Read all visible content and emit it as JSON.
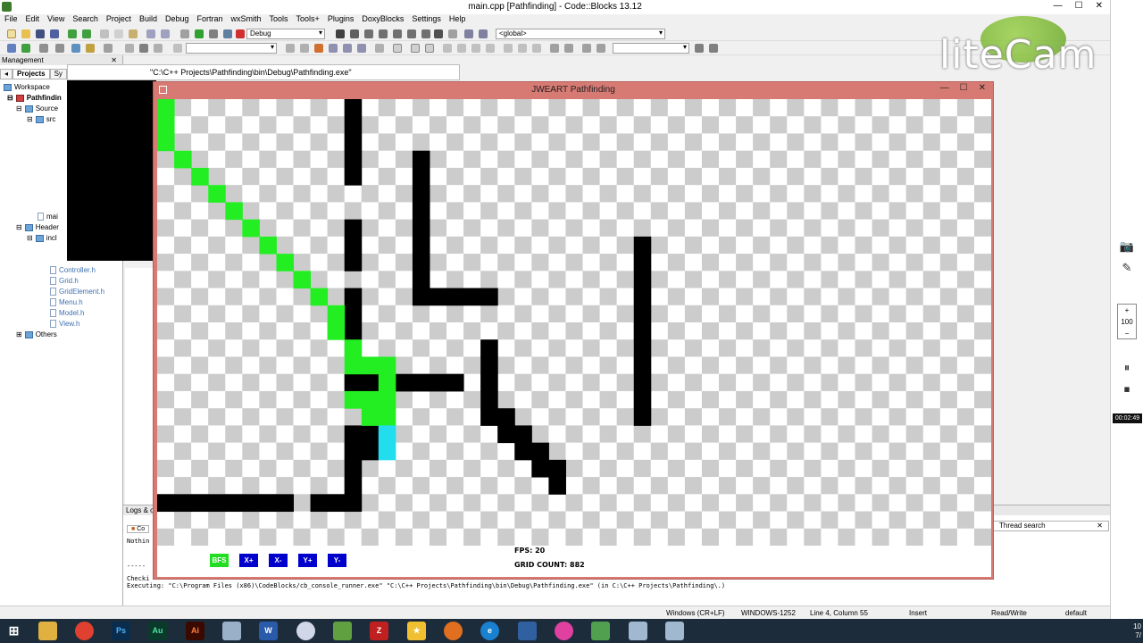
{
  "window": {
    "title": "main.cpp [Pathfinding] - Code::Blocks 13.12",
    "controls": [
      "—",
      "☐",
      "✕"
    ]
  },
  "menu": [
    "File",
    "Edit",
    "View",
    "Search",
    "Project",
    "Build",
    "Debug",
    "Fortran",
    "wxSmith",
    "Tools",
    "Tools+",
    "Plugins",
    "DoxyBlocks",
    "Settings",
    "Help"
  ],
  "toolbar": {
    "build_target": "Debug",
    "scope": "<global>"
  },
  "management": {
    "header": "Management",
    "tabs": [
      "Projects",
      "Sy"
    ],
    "tree": [
      {
        "label": "Workspace",
        "type": "folder"
      },
      {
        "label": "Pathfindin",
        "type": "project"
      },
      {
        "label": "Source",
        "type": "folder"
      },
      {
        "label": "src",
        "type": "folder"
      },
      {
        "label": "mai",
        "type": "file"
      },
      {
        "label": "Header",
        "type": "folder"
      },
      {
        "label": "incl",
        "type": "folder"
      },
      {
        "label": "Controller.h",
        "type": "file"
      },
      {
        "label": "Grid.h",
        "type": "file"
      },
      {
        "label": "GridElement.h",
        "type": "file"
      },
      {
        "label": "Menu.h",
        "type": "file"
      },
      {
        "label": "Model.h",
        "type": "file"
      },
      {
        "label": "View.h",
        "type": "file"
      },
      {
        "label": "Others",
        "type": "folder"
      }
    ]
  },
  "console_window": {
    "title": "\"C:\\C++ Projects\\Pathfinding\\bin\\Debug\\Pathfinding.exe\""
  },
  "logs": {
    "header": "Logs & ot",
    "tab": "Co",
    "lines": [
      "Nothin",
      "-----",
      "Checki",
      "Executing: \"C:\\Program Files (x86)\\CodeBlocks/cb_console_runner.exe\" \"C:\\C++ Projects\\Pathfinding\\bin\\Debug\\Pathfinding.exe\"  (in C:\\C++ Projects\\Pathfinding\\.)"
    ],
    "thread_search": "Thread search"
  },
  "statusbar": {
    "line_endings": "Windows (CR+LF)",
    "encoding": "WINDOWS-1252",
    "position": "Line 4, Column 55",
    "mode": "Insert",
    "access": "Read/Write",
    "profile": "default"
  },
  "pathfinding": {
    "title": "JWEART Pathfinding",
    "buttons": [
      {
        "label": "BFS",
        "color": "#22dd22"
      },
      {
        "label": "X+",
        "color": "#0000cc"
      },
      {
        "label": "X-",
        "color": "#0000cc"
      },
      {
        "label": "Y+",
        "color": "#0000cc"
      },
      {
        "label": "Y-",
        "color": "#0000cc"
      }
    ],
    "fps": "FPS: 20",
    "grid_count": "GRID COUNT: 882",
    "grid": {
      "cols": 49,
      "rows": 26,
      "walls": [
        [
          11,
          0
        ],
        [
          11,
          1
        ],
        [
          11,
          2
        ],
        [
          11,
          3
        ],
        [
          11,
          4
        ],
        [
          15,
          3
        ],
        [
          15,
          4
        ],
        [
          15,
          5
        ],
        [
          15,
          6
        ],
        [
          15,
          7
        ],
        [
          15,
          8
        ],
        [
          15,
          9
        ],
        [
          15,
          10
        ],
        [
          15,
          11
        ],
        [
          11,
          7
        ],
        [
          11,
          8
        ],
        [
          11,
          9
        ],
        [
          16,
          11
        ],
        [
          17,
          11
        ],
        [
          18,
          11
        ],
        [
          19,
          11
        ],
        [
          11,
          11
        ],
        [
          11,
          12
        ],
        [
          11,
          13
        ],
        [
          11,
          16
        ],
        [
          12,
          16
        ],
        [
          13,
          16
        ],
        [
          14,
          16
        ],
        [
          15,
          16
        ],
        [
          16,
          16
        ],
        [
          17,
          16
        ],
        [
          19,
          14
        ],
        [
          19,
          15
        ],
        [
          19,
          16
        ],
        [
          19,
          17
        ],
        [
          19,
          18
        ],
        [
          20,
          18
        ],
        [
          20,
          19
        ],
        [
          21,
          19
        ],
        [
          21,
          20
        ],
        [
          22,
          20
        ],
        [
          22,
          21
        ],
        [
          23,
          21
        ],
        [
          23,
          22
        ],
        [
          28,
          8
        ],
        [
          28,
          9
        ],
        [
          28,
          10
        ],
        [
          28,
          11
        ],
        [
          28,
          12
        ],
        [
          28,
          13
        ],
        [
          28,
          14
        ],
        [
          28,
          15
        ],
        [
          28,
          16
        ],
        [
          28,
          17
        ],
        [
          28,
          18
        ],
        [
          11,
          19
        ],
        [
          12,
          19
        ],
        [
          11,
          20
        ],
        [
          12,
          20
        ],
        [
          11,
          21
        ],
        [
          11,
          22
        ],
        [
          0,
          23
        ],
        [
          1,
          23
        ],
        [
          2,
          23
        ],
        [
          3,
          23
        ],
        [
          4,
          23
        ],
        [
          5,
          23
        ],
        [
          6,
          23
        ],
        [
          7,
          23
        ],
        [
          9,
          23
        ],
        [
          10,
          23
        ],
        [
          11,
          23
        ]
      ],
      "path": [
        [
          0,
          0
        ],
        [
          0,
          1
        ],
        [
          0,
          2
        ],
        [
          1,
          3
        ],
        [
          2,
          4
        ],
        [
          3,
          5
        ],
        [
          4,
          6
        ],
        [
          5,
          7
        ],
        [
          6,
          8
        ],
        [
          7,
          9
        ],
        [
          8,
          10
        ],
        [
          9,
          11
        ],
        [
          10,
          12
        ],
        [
          10,
          13
        ],
        [
          11,
          14
        ],
        [
          11,
          15
        ],
        [
          12,
          15
        ],
        [
          13,
          15
        ],
        [
          13,
          16
        ],
        [
          13,
          17
        ],
        [
          13,
          18
        ],
        [
          11,
          17
        ],
        [
          12,
          17
        ],
        [
          12,
          18
        ]
      ],
      "goal": [
        [
          13,
          19
        ],
        [
          13,
          20
        ]
      ],
      "path_color": "#22ee22",
      "goal_color": "#22ddee",
      "wall_color": "#000000"
    }
  },
  "right_panel": {
    "zoom": "100",
    "timer": "00:02:49",
    "plus": "+",
    "minus": "−"
  },
  "watermark": "liteCam",
  "taskbar": {
    "clock": [
      "10",
      "7/"
    ]
  }
}
